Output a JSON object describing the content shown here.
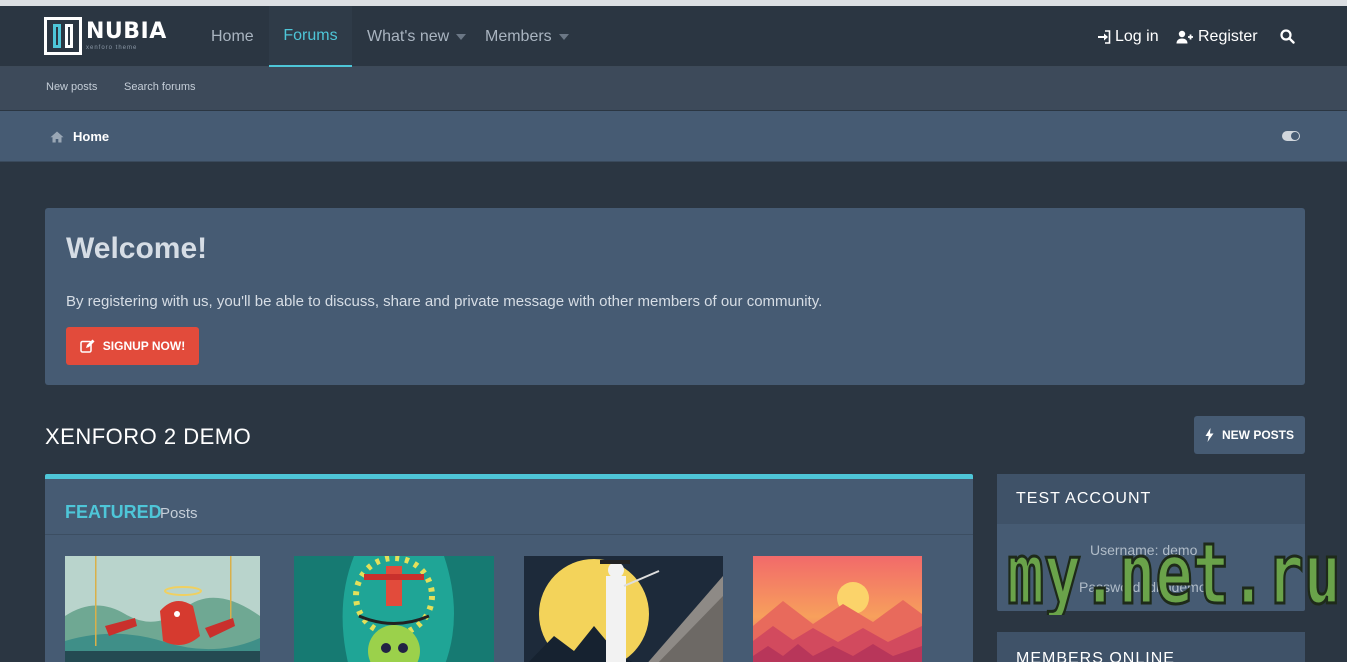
{
  "brand": {
    "name": "NUBIA",
    "tagline": "xenforo theme"
  },
  "nav": {
    "tabs": [
      {
        "label": "Home"
      },
      {
        "label": "Forums"
      },
      {
        "label": "What's new"
      },
      {
        "label": "Members"
      }
    ],
    "login": "Log in",
    "register": "Register"
  },
  "subnav": {
    "new_posts": "New posts",
    "search_forums": "Search forums"
  },
  "breadcrumb": {
    "home": "Home"
  },
  "welcome": {
    "title": "Welcome!",
    "text": "By registering with us, you'll be able to discuss, share and private message with other members of our community.",
    "signup": "SIGNUP NOW!"
  },
  "section": {
    "title": "XENFORO 2 DEMO",
    "new_posts_button": "NEW POSTS"
  },
  "featured": {
    "accent": "FEATURED",
    "rest": "Posts"
  },
  "sidebar": {
    "test_account": {
      "title": "TEST ACCOUNT",
      "username": "Username: demo",
      "password": "Password: dbhdemo"
    },
    "members_online": {
      "title": "MEMBERS ONLINE"
    }
  },
  "watermark": "my.net.ru",
  "colors": {
    "accent": "#4ec6d8",
    "signup": "#e24b3b",
    "panel": "#465b73",
    "background": "#2b3642"
  }
}
